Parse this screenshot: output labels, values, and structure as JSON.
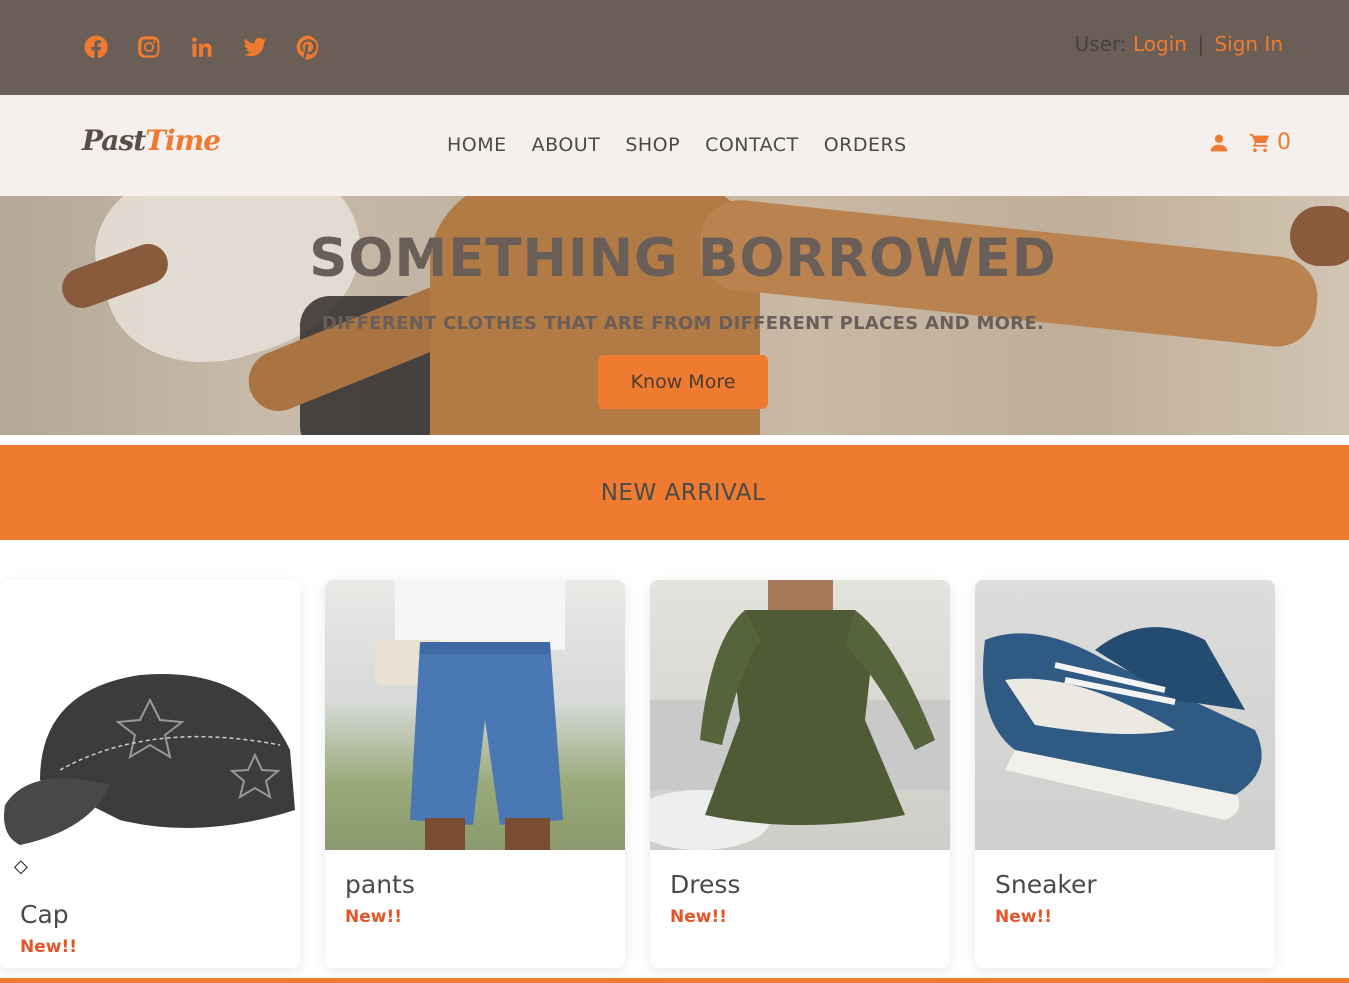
{
  "topbar": {
    "social": [
      "facebook-icon",
      "instagram-icon",
      "linkedin-icon",
      "twitter-icon",
      "pinterest-icon"
    ],
    "user_label": "User:",
    "login": "Login",
    "separator": "|",
    "signin": "Sign In"
  },
  "nav": {
    "logo_part1": "Past",
    "logo_part2": "Time",
    "items": [
      "HOME",
      "ABOUT",
      "SHOP",
      "CONTACT",
      "ORDERS"
    ],
    "cart_count": "0"
  },
  "hero": {
    "title": "SOMETHING BORROWED",
    "subtitle": "DIFFERENT CLOTHES THAT ARE FROM DIFFERENT PLACES AND MORE.",
    "button": "Know More"
  },
  "section": {
    "title": "NEW ARRIVAL"
  },
  "products": [
    {
      "name": "Cap",
      "tag": "New!!"
    },
    {
      "name": "pants",
      "tag": "New!!"
    },
    {
      "name": "Dress",
      "tag": "New!!"
    },
    {
      "name": "Sneaker",
      "tag": "New!!"
    }
  ],
  "colors": {
    "accent": "#ee7b30",
    "topbar_bg": "#6b5e57",
    "nav_bg": "#f5f0ee",
    "tag": "#e2562a"
  }
}
